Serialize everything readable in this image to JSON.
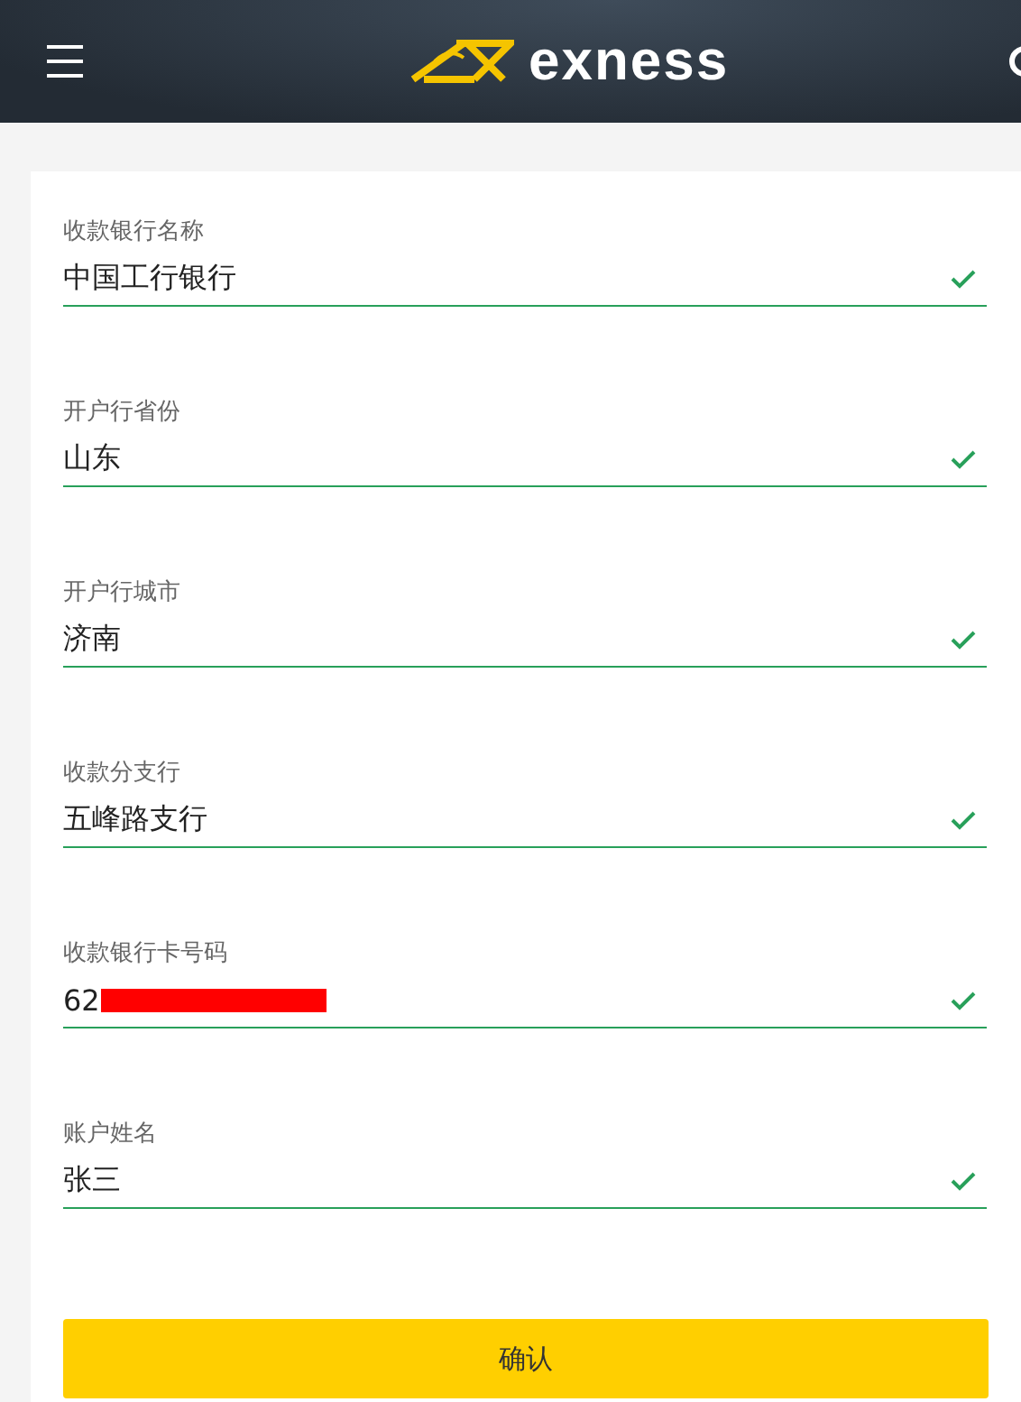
{
  "header": {
    "logo": "exness"
  },
  "fields": [
    {
      "label": "收款银行名称",
      "value": "中国工行银行",
      "valid": true,
      "redacted": false
    },
    {
      "label": "开户行省份",
      "value": "山东",
      "valid": true,
      "redacted": false
    },
    {
      "label": "开户行城市",
      "value": "济南",
      "valid": true,
      "redacted": false
    },
    {
      "label": "收款分支行",
      "value": "五峰路支行",
      "valid": true,
      "redacted": false
    },
    {
      "label": "收款银行卡号码",
      "value": "62",
      "valid": true,
      "redacted": true
    },
    {
      "label": "账户姓名",
      "value": "张三",
      "valid": true,
      "redacted": false
    }
  ],
  "submit": "确认"
}
